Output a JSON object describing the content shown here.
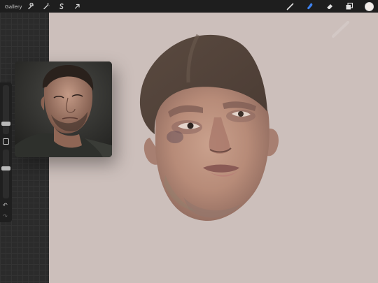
{
  "toolbar": {
    "gallery_label": "Gallery",
    "left_tools": [
      "wrench-icon",
      "magic-wand-icon",
      "selection-s-icon",
      "transform-arrow-icon"
    ],
    "right_tools": [
      "brush-icon",
      "smudge-icon",
      "eraser-icon",
      "layers-icon"
    ],
    "active_tool": "smudge-icon",
    "active_color": "#f3ede9"
  },
  "sidebar": {
    "size_slider_level": 0.72,
    "opacity_slider_level": 0.35,
    "icons": [
      "modify-square-icon",
      "undo-icon",
      "redo-icon"
    ]
  },
  "colors": {
    "toolbar_bg": "#1e1e1e",
    "canvas_bg": "#ccbfbb",
    "accent_active_tool": "#3d82f0"
  }
}
